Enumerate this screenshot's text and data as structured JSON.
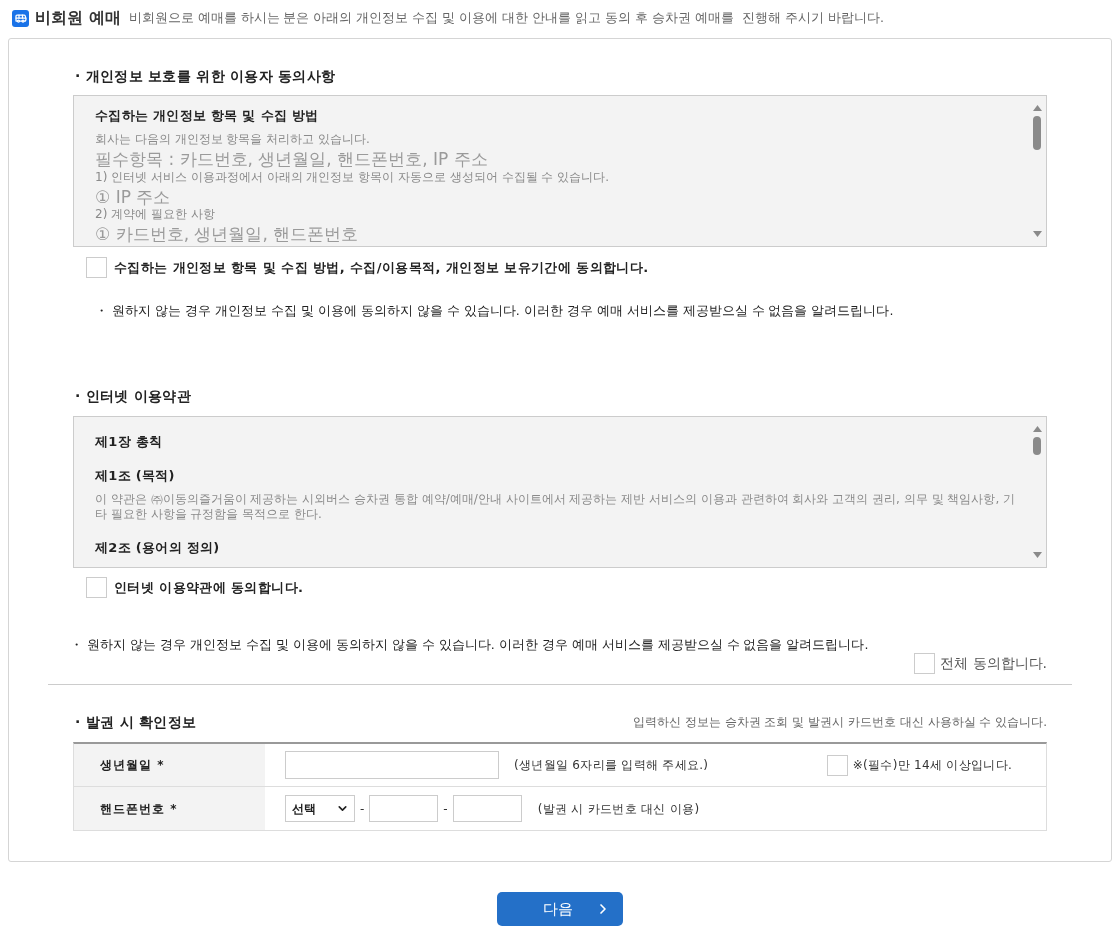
{
  "header": {
    "title": "비회원 예매",
    "description": "비회원으로 예매를 하시는 분은 아래의 개인정보 수집 및 이용에 대한 안내를 읽고 동의 후 승차권 예매를  진행해 주시기 바랍니다."
  },
  "privacy": {
    "title": "· 개인정보 보호를 위한 이용자 동의사항",
    "content": [
      {
        "kind": "heading",
        "text": "수집하는 개인정보 항목 및 수집 방법"
      },
      {
        "kind": "text",
        "text": "회사는 다음의 개인정보 항목을 처리하고 있습니다."
      },
      {
        "kind": "large",
        "text": "필수항목 : 카드번호, 생년월일, 핸드폰번호, IP 주소"
      },
      {
        "kind": "text",
        "text": "1) 인터넷 서비스 이용과정에서 아래의 개인정보 항목이 자동으로 생성되어 수집될 수 있습니다."
      },
      {
        "kind": "large",
        "text": "① IP 주소"
      },
      {
        "kind": "text",
        "text": "2) 계약에 필요한 사항"
      },
      {
        "kind": "large",
        "text": "① 카드번호, 생년월일, 핸드폰번호"
      }
    ],
    "agree": {
      "label": "수집하는 개인정보 항목 및 수집 방법, 수집/이용목적, 개인정보 보유기간에 동의합니다.",
      "checked": false
    },
    "notice": "・ 원하지 않는 경우 개인정보 수집 및 이용에 동의하지 않을 수 있습니다. 이러한 경우 예매 서비스를 제공받으실 수 없음을 알려드립니다."
  },
  "terms": {
    "title": "· 인터넷 이용약관",
    "content": [
      {
        "kind": "heading",
        "text": "제1장 총칙"
      },
      {
        "kind": "heading",
        "text": "제1조 (목적)"
      },
      {
        "kind": "text",
        "text": "이 약관은 ㈜이동의즐거움이 제공하는 시외버스 승차권 통합 예약/예매/안내 사이트에서 제공하는 제반 서비스의 이용과 관련하여 회사와 고객의 권리, 의무 및 책임사항, 기타 필요한 사항을 규정함을 목적으로 한다."
      },
      {
        "kind": "heading",
        "text": "제2조 (용어의 정의)"
      }
    ],
    "agree": {
      "label": "인터넷 이용약관에 동의합니다.",
      "checked": false
    }
  },
  "notice": "・ 원하지 않는 경우 개인정보 수집 및 이용에 동의하지 않을 수 있습니다. 이러한 경우 예매 서비스를 제공받으실 수 없음을 알려드립니다.",
  "agree_all": {
    "label": "전체 동의합니다.",
    "checked": false
  },
  "ticket_info": {
    "title": "· 발권 시 확인정보",
    "note": "입력하신 정보는 승차권 조회 및 발권시 카드번호 대신 사용하실 수 있습니다.",
    "rows": [
      {
        "kind": "birthdate",
        "label": "생년월일 *",
        "hint": "(생년월일 6자리를 입력해 주세요.)",
        "age_check": {
          "label": "※(필수)만 14세 이상입니다.",
          "checked": false
        }
      },
      {
        "kind": "phone",
        "label": "핸드폰번호 *",
        "select": "선택",
        "separators": [
          "-",
          "-"
        ],
        "hint": "(발권 시 카드번호 대신 이용)"
      }
    ]
  },
  "next_button": {
    "label": "다음"
  }
}
